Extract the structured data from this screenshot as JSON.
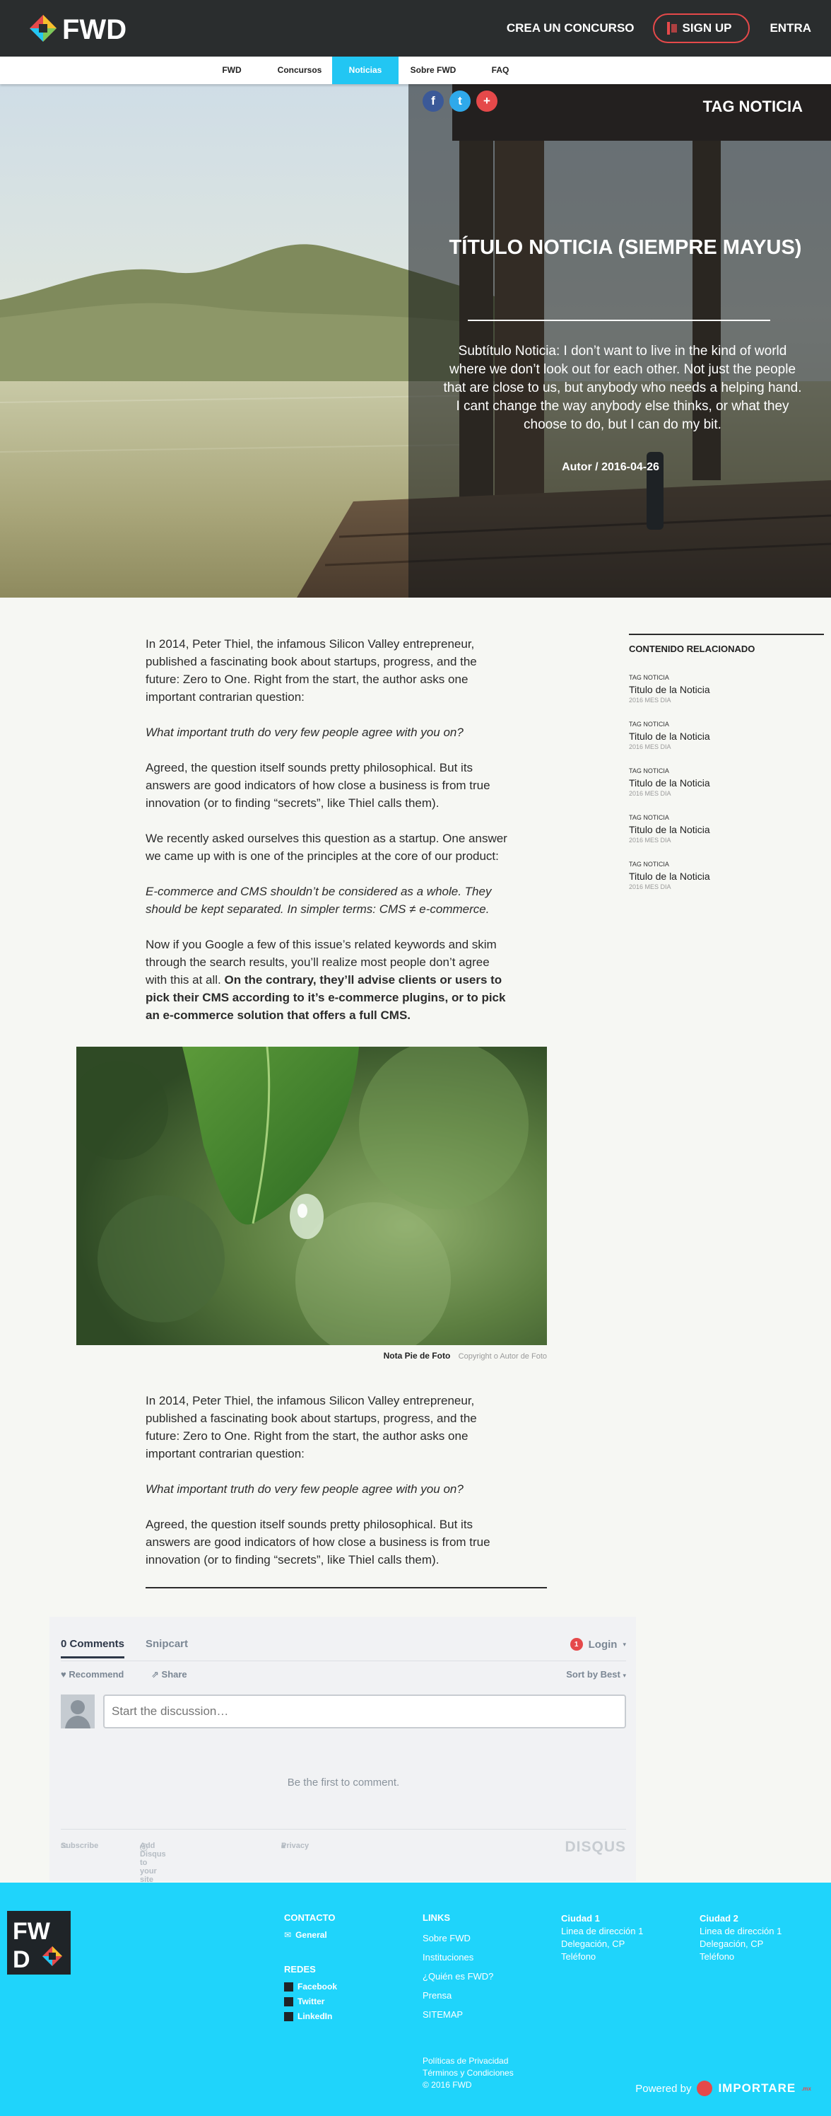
{
  "header": {
    "crea": "CREA UN CONCURSO",
    "signup": "SIGN UP",
    "entra": "ENTRA"
  },
  "nav": {
    "tabs": [
      "FWD",
      "Concursos",
      "Noticias",
      "Sobre FWD",
      "FAQ"
    ],
    "active": "Noticias"
  },
  "hero": {
    "tag": "TAG NOTICIA",
    "title": "TÍTULO NOTICIA (SIEMPRE MAYUS)",
    "subtitle": "Subtítulo Noticia: I don’t want to live in the kind of world where we don’t look out for each other. Not just the people that are close to us, but anybody who needs a helping hand. I cant change the way anybody else thinks, or what they choose to do, but I can do my bit.",
    "author": "Autor / 2016-04-26",
    "share": [
      "f",
      "t",
      "+"
    ]
  },
  "article": {
    "p1": "In 2014, Peter Thiel, the infamous Silicon Valley entrepreneur, published a fascinating book about startups, progress, and the future: Zero to One. Right from the start, the author asks one important contrarian question:",
    "q1": "What important truth do very few people agree with you on?",
    "p2": "Agreed, the question itself sounds pretty philosophical. But its answers are good indicators of how close a business is from true innovation (or to finding “secrets”, like Thiel calls them).",
    "p3": "We recently asked ourselves this question as a startup. One answer we came up with is one of the principles at the core of our product:",
    "q2": "E-commerce and CMS shouldn’t be considered as a whole. They should be kept separated. In simpler terms: CMS ≠ e-commerce.",
    "p4_start": "Now if you Google a few of this issue’s related keywords and skim through the search results, you’ll realize most people don’t agree with this at all. ",
    "p4_bold": "On the contrary, they’ll advise clients or users to pick their CMS according to it’s e-commerce plugins, or to pick an e-commerce solution that offers a full CMS.",
    "caption": "Nota Pie de Foto",
    "copyright": "Copyright o Autor de Foto",
    "p5": "In 2014, Peter Thiel, the infamous Silicon Valley entrepreneur, published a fascinating book about startups, progress, and the future: Zero to One. Right from the start, the author asks one important contrarian question:",
    "q3": "What important truth do very few people agree with you on?",
    "p6": "Agreed, the question itself sounds pretty philosophical. But its answers are good indicators of how close a business is from true innovation (or to finding “secrets”, like Thiel calls them)."
  },
  "sidebar": {
    "title": "CONTENIDO RELACIONADO",
    "items": [
      {
        "tag": "TAG NOTICIA",
        "title": "Titulo de la Noticia",
        "date": "2016 MES DIA"
      },
      {
        "tag": "TAG NOTICIA",
        "title": "Titulo de la Noticia",
        "date": "2016 MES DIA"
      },
      {
        "tag": "TAG NOTICIA",
        "title": "Titulo de la Noticia",
        "date": "2016 MES DIA"
      },
      {
        "tag": "TAG NOTICIA",
        "title": "Titulo de la Noticia",
        "date": "2016 MES DIA"
      },
      {
        "tag": "TAG NOTICIA",
        "title": "Titulo de la Noticia",
        "date": "2016 MES DIA"
      }
    ]
  },
  "disqus": {
    "comments_tab": "0 Comments",
    "snipcart_tab": "Snipcart",
    "login_badge": "1",
    "login": "Login",
    "recommend": "Recommend",
    "share": "Share",
    "sort": "Sort by Best",
    "placeholder": "Start the discussion…",
    "empty": "Be the first to comment.",
    "subscribe": "Subscribe",
    "add_disqus": "Add Disqus to your site",
    "privacy": "Privacy",
    "brand": "DISQUS"
  },
  "footer": {
    "contacto": "CONTACTO",
    "general": "General",
    "redes": "REDES",
    "social": [
      "Facebook",
      "Twitter",
      "LinkedIn"
    ],
    "links_title": "LINKS",
    "links": [
      "Sobre FWD",
      "Instituciones",
      "¿Quién es FWD?",
      "Prensa",
      "SITEMAP"
    ],
    "city1": {
      "name": "Ciudad 1",
      "lines": [
        "Linea de dirección 1",
        "Delegación, CP",
        "Teléfono"
      ]
    },
    "city2": {
      "name": "Ciudad 2",
      "lines": [
        "Linea de dirección 1",
        "Delegación, CP",
        "Teléfono"
      ]
    },
    "legal": [
      "Políticas de Privacidad",
      "Términos y Condiciones",
      "© 2016 FWD"
    ],
    "powered": "Powered by",
    "importare": "IMPORTARE",
    "importare_tld": ".mx"
  },
  "colors": {
    "accent": "#22c6f3",
    "footer": "#1fd4fb",
    "red": "#e5494a",
    "dark": "#2a2d2e"
  }
}
